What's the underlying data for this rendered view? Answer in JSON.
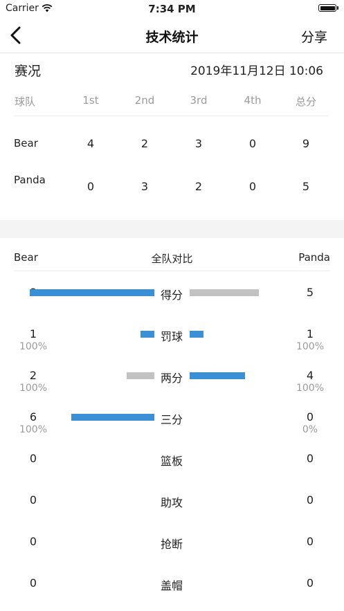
{
  "status_bar": {
    "carrier": "Carrier",
    "time": "7:34 PM"
  },
  "nav": {
    "title": "技术统计",
    "share": "分享"
  },
  "score": {
    "title": "赛况",
    "datetime": "2019年11月12日 10:06",
    "headers": [
      "球队",
      "1st",
      "2nd",
      "3rd",
      "4th",
      "总分"
    ],
    "rows": [
      {
        "team": "Bear",
        "q1": "4",
        "q2": "2",
        "q3": "3",
        "q4": "0",
        "total": "9"
      },
      {
        "team": "Panda",
        "q1": "0",
        "q2": "3",
        "q3": "2",
        "q4": "0",
        "total": "5"
      }
    ]
  },
  "compare": {
    "left_team": "Bear",
    "center_title": "全队对比",
    "right_team": "Panda",
    "rows": [
      {
        "label": "得分",
        "left": "9",
        "left_pct": "",
        "right": "5",
        "right_pct": "",
        "left_bar": 9,
        "right_bar": 5,
        "left_color": "#3b8fd5",
        "right_color": "#c2c2c2"
      },
      {
        "label": "罚球",
        "left": "1",
        "left_pct": "100%",
        "right": "1",
        "right_pct": "100%",
        "left_bar": 1,
        "right_bar": 1,
        "left_color": "#3b8fd5",
        "right_color": "#3b8fd5"
      },
      {
        "label": "两分",
        "left": "2",
        "left_pct": "100%",
        "right": "4",
        "right_pct": "100%",
        "left_bar": 2,
        "right_bar": 4,
        "left_color": "#c2c2c2",
        "right_color": "#3b8fd5"
      },
      {
        "label": "三分",
        "left": "6",
        "left_pct": "100%",
        "right": "0",
        "right_pct": "0%",
        "left_bar": 6,
        "right_bar": 0,
        "left_color": "#3b8fd5",
        "right_color": "#c2c2c2"
      },
      {
        "label": "篮板",
        "left": "0",
        "left_pct": "",
        "right": "0",
        "right_pct": ""
      },
      {
        "label": "助攻",
        "left": "0",
        "left_pct": "",
        "right": "0",
        "right_pct": ""
      },
      {
        "label": "抢断",
        "left": "0",
        "left_pct": "",
        "right": "0",
        "right_pct": ""
      },
      {
        "label": "盖帽",
        "left": "0",
        "left_pct": "",
        "right": "0",
        "right_pct": ""
      }
    ]
  }
}
